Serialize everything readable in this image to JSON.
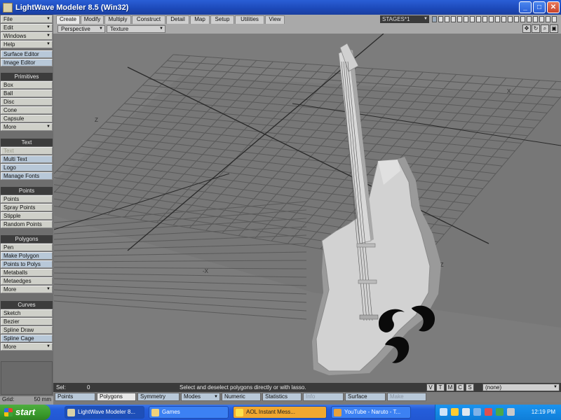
{
  "window": {
    "title": "LightWave Modeler 8.5 (Win32)",
    "minimize": "_",
    "maximize": "□",
    "close": "✕"
  },
  "menu": {
    "items": [
      "File",
      "Edit",
      "Windows",
      "Help"
    ],
    "editors": [
      "Surface Editor",
      "Image Editor"
    ]
  },
  "primitives": {
    "header": "Primitives",
    "items": [
      "Box",
      "Ball",
      "Disc",
      "Cone",
      "Capsule",
      "More"
    ]
  },
  "text_group": {
    "header": "Text",
    "items": [
      "Text",
      "Multi Text",
      "Logo",
      "Manage Fonts"
    ]
  },
  "points_group": {
    "header": "Points",
    "items": [
      "Points",
      "Spray Points",
      "Stipple",
      "Random Points"
    ]
  },
  "polygons_group": {
    "header": "Polygons",
    "items": [
      "Pen",
      "Make Polygon",
      "Points to Polys",
      "Metaballs",
      "Metaedges",
      "More"
    ]
  },
  "curves_group": {
    "header": "Curves",
    "items": [
      "Sketch",
      "Bezier",
      "Spline Draw",
      "Spline Cage",
      "More"
    ]
  },
  "grid": {
    "label": "Grid:",
    "value": "50 mm"
  },
  "tabs": [
    "Create",
    "Modify",
    "Multiply",
    "Construct",
    "Detail",
    "Map",
    "Setup",
    "Utilities",
    "View"
  ],
  "stages": "STAGES*1",
  "viewport": {
    "view": "Perspective",
    "shading": "Texture",
    "axis_labels": [
      "X",
      "Z",
      "-X",
      "-Z"
    ],
    "controls": [
      "✥",
      "↻",
      "⌕",
      "▣"
    ]
  },
  "status": {
    "sel_label": "Sel:",
    "sel_count": "0",
    "hint": "Select and deselect polygons directly or with lasso.",
    "toggles": [
      "V",
      "T",
      "M",
      "C",
      "S"
    ],
    "surface_drop": "(none)"
  },
  "modes": {
    "points": "Points",
    "polygons": "Polygons",
    "symmetry": "Symmetry",
    "modes": "Modes",
    "numeric": "Numeric",
    "statistics": "Statistics",
    "info": "Info",
    "surface": "Surface",
    "make": "Make"
  },
  "taskbar": {
    "start": "start",
    "tasks": [
      "LightWave Modeler 8...",
      "Games",
      "AOL Instant Mess...",
      "YouTube - Naruto - T..."
    ],
    "clock": "12:19 PM"
  },
  "colors": {
    "guitar": "#d2d2d2",
    "emblem": "#0a0a0a",
    "viewport_bg": "#7c7c7c",
    "xp_blue": "#245edb"
  }
}
